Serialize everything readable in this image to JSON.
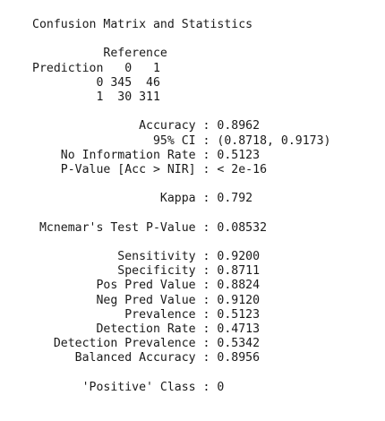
{
  "console": {
    "lines": [
      "Confusion Matrix and Statistics",
      "",
      "          Reference",
      "Prediction   0   1",
      "         0 345  46",
      "         1  30 311",
      "",
      "               Accuracy : 0.8962",
      "                 95% CI : (0.8718, 0.9173)",
      "    No Information Rate : 0.5123",
      "    P-Value [Acc > NIR] : < 2e-16",
      "",
      "                  Kappa : 0.792",
      "",
      " Mcnemar's Test P-Value : 0.08532",
      "",
      "            Sensitivity : 0.9200",
      "            Specificity : 0.8711",
      "         Pos Pred Value : 0.8824",
      "         Neg Pred Value : 0.9120",
      "             Prevalence : 0.5123",
      "         Detection Rate : 0.4713",
      "   Detection Prevalence : 0.5342",
      "      Balanced Accuracy : 0.8956",
      "",
      "       'Positive' Class : 0"
    ]
  }
}
